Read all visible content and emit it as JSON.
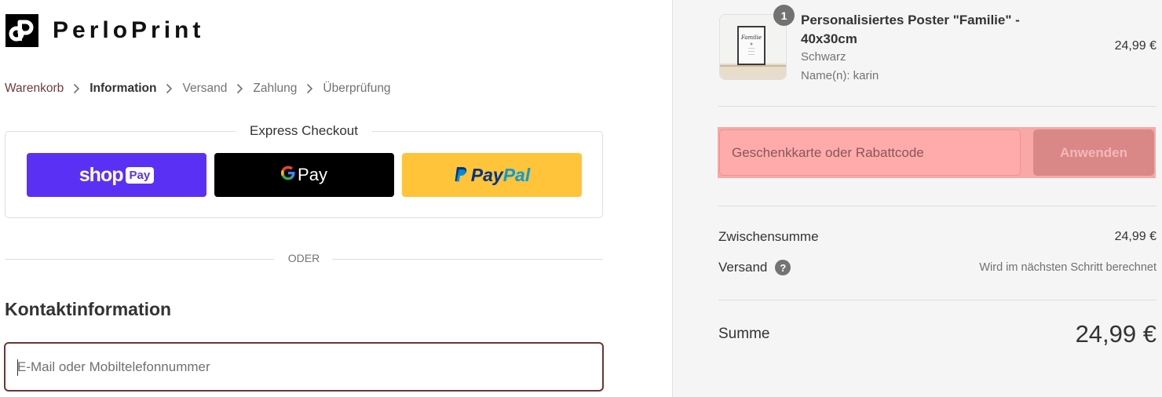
{
  "brand": {
    "name": "PerloPrint",
    "logo_icon": "perloprint-logo-icon"
  },
  "breadcrumb": [
    {
      "label": "Warenkorb",
      "state": "link"
    },
    {
      "label": "Information",
      "state": "current"
    },
    {
      "label": "Versand",
      "state": "upcoming"
    },
    {
      "label": "Zahlung",
      "state": "upcoming"
    },
    {
      "label": "Überprüfung",
      "state": "upcoming"
    }
  ],
  "express_checkout": {
    "title": "Express Checkout",
    "buttons": [
      {
        "id": "shop_pay",
        "word": "shop",
        "badge": "Pay",
        "color": "#5a31f4"
      },
      {
        "id": "google_pay",
        "g": "G",
        "word": "Pay",
        "color": "#000000"
      },
      {
        "id": "paypal",
        "word_1": "Pay",
        "word_2": "Pal",
        "color": "#ffc439"
      }
    ]
  },
  "divider_text": "ODER",
  "contact": {
    "title": "Kontaktinformation",
    "email_placeholder": "E-Mail oder Mobiltelefonnummer",
    "email_value": ""
  },
  "order_summary": {
    "items": [
      {
        "name": "Personalisiertes Poster \"Familie\" - 40x30cm",
        "variant": "Schwarz",
        "option": "Name(n): karin",
        "quantity": "1",
        "price": "24,99 €",
        "thumbnail_text": "Familie"
      }
    ],
    "discount": {
      "placeholder": "Geschenkkarte oder Rabattcode",
      "value": "",
      "apply_label": "Anwenden"
    },
    "subtotal": {
      "label": "Zwischensumme",
      "value": "24,99 €"
    },
    "shipping": {
      "label": "Versand",
      "value": "Wird im nächsten Schritt berechnet",
      "help_icon": "question-icon"
    },
    "total": {
      "label": "Summe",
      "value": "24,99 €"
    }
  },
  "colors": {
    "accent": "#6b3535",
    "link": "#6b3b3b",
    "sidebar_bg": "#f5f5f5",
    "discount_highlight": "#f9a7a7"
  }
}
